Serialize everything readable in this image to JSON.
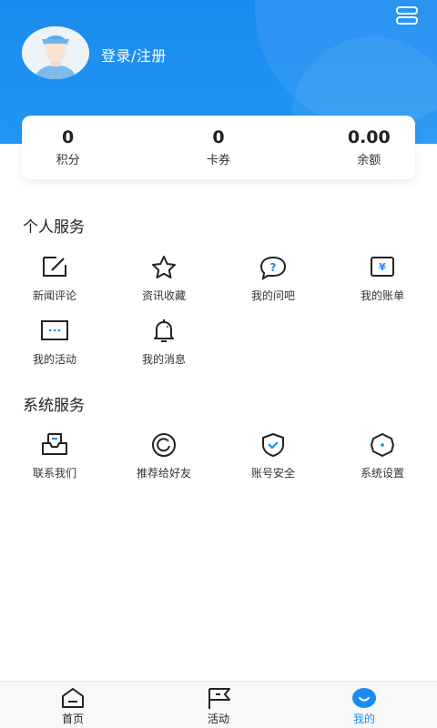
{
  "header": {
    "login_label": "登录/注册"
  },
  "stats": [
    {
      "value": "0",
      "label": "积分"
    },
    {
      "value": "0",
      "label": "卡券"
    },
    {
      "value": "0.00",
      "label": "余额"
    }
  ],
  "personal": {
    "title": "个人服务",
    "items": [
      {
        "label": "新闻评论",
        "icon": "edit-icon"
      },
      {
        "label": "资讯收藏",
        "icon": "star-icon"
      },
      {
        "label": "我的问吧",
        "icon": "question-icon"
      },
      {
        "label": "我的账单",
        "icon": "yen-bill-icon"
      },
      {
        "label": "我的活动",
        "icon": "activity-card-icon"
      },
      {
        "label": "我的消息",
        "icon": "bell-icon"
      }
    ]
  },
  "system": {
    "title": "系统服务",
    "items": [
      {
        "label": "联系我们",
        "icon": "inbox-icon"
      },
      {
        "label": "推荐给好友",
        "icon": "share-circle-icon"
      },
      {
        "label": "账号安全",
        "icon": "shield-check-icon"
      },
      {
        "label": "系统设置",
        "icon": "settings-icon"
      }
    ]
  },
  "tabbar": {
    "items": [
      {
        "label": "首页",
        "icon": "home-icon"
      },
      {
        "label": "活动",
        "icon": "flag-icon"
      },
      {
        "label": "我的",
        "icon": "profile-smile-icon"
      }
    ],
    "active": "我的"
  },
  "colors": {
    "accent": "#1a8cf0",
    "header": "#2196f3"
  }
}
